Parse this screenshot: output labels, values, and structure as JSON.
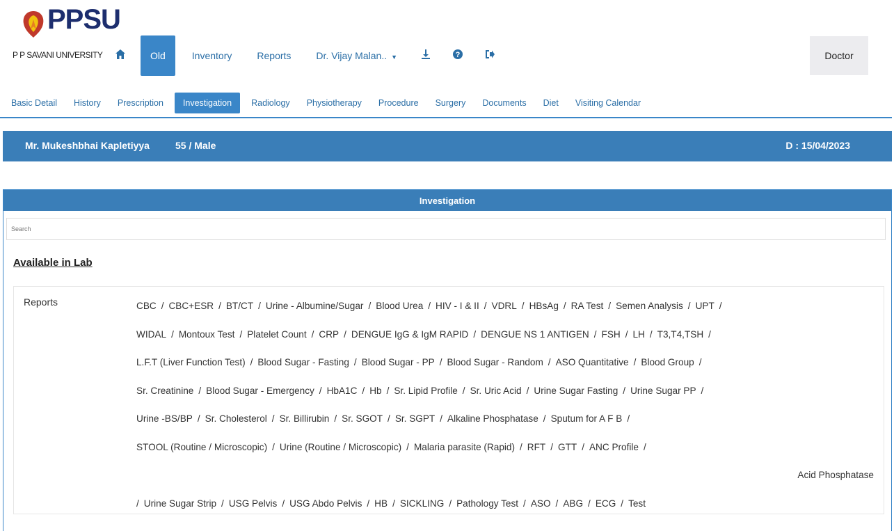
{
  "logo": {
    "brand": "PPSU",
    "university": "P P SAVANI UNIVERSITY"
  },
  "nav": {
    "home_icon": "home-icon",
    "old_label": "Old",
    "inventory_label": "Inventory",
    "reports_label": "Reports",
    "user_label": "Dr. Vijay Malan..",
    "download_icon": "download-icon",
    "help_icon": "help-icon",
    "logout_icon": "logout-icon",
    "role_label": "Doctor"
  },
  "tabs": [
    "Basic Detail",
    "History",
    "Prescription",
    "Investigation",
    "Radiology",
    "Physiotherapy",
    "Procedure",
    "Surgery",
    "Documents",
    "Diet",
    "Visiting Calendar"
  ],
  "active_tab": "Investigation",
  "patient": {
    "name": "Mr. Mukeshbhai Kapletiyya",
    "age_gender": "55 / Male",
    "date": "D : 15/04/2023"
  },
  "investigation": {
    "title": "Investigation",
    "search_placeholder": "Search",
    "available_heading": "Available in Lab",
    "reports_label": "Reports",
    "lines": [
      [
        "CBC",
        "CBC+ESR",
        "BT/CT",
        "Urine - Albumine/Sugar",
        "Blood Urea",
        "HIV - I & II",
        "VDRL",
        "HBsAg",
        "RA Test",
        "Semen Analysis",
        "UPT"
      ],
      [
        "WIDAL",
        "Montoux Test",
        "Platelet Count",
        "CRP",
        "DENGUE IgG & IgM RAPID",
        "DENGUE NS 1 ANTIGEN",
        "FSH",
        "LH",
        "T3,T4,TSH"
      ],
      [
        "L.F.T (Liver Function Test)",
        "Blood Sugar - Fasting",
        "Blood Sugar - PP",
        "Blood Sugar - Random",
        "ASO Quantitative",
        "Blood Group"
      ],
      [
        "Sr. Creatinine",
        "Blood Sugar - Emergency",
        "HbA1C",
        "Hb",
        "Sr. Lipid Profile",
        "Sr. Uric Acid",
        "Urine Sugar Fasting",
        "Urine Sugar PP"
      ],
      [
        "Urine -BS/BP",
        "Sr. Cholesterol",
        "Sr. Billirubin",
        "Sr. SGOT",
        "Sr. SGPT",
        "Alkaline Phosphatase",
        "Sputum for A F B"
      ],
      [
        "STOOL (Routine / Microscopic)",
        "Urine (Routine / Microscopic)",
        "Malaria parasite (Rapid)",
        "RFT",
        "GTT",
        "ANC Profile"
      ],
      [
        "Acid Phosphatase"
      ],
      [
        "Urine Sugar Strip",
        "USG Pelvis",
        "USG Abdo Pelvis",
        "HB",
        "SICKLING",
        "Pathology Test",
        "ASO",
        "ABG",
        "ECG",
        "Test"
      ]
    ]
  }
}
